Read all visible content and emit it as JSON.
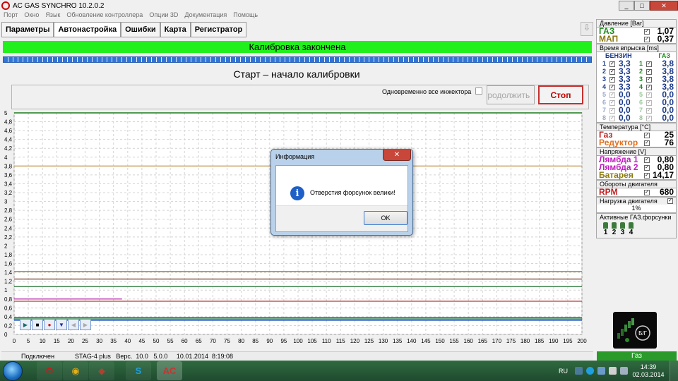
{
  "window": {
    "title": "AC GAS SYNCHRO  10.2.0.2",
    "ctrl_min": "_",
    "ctrl_max": "□",
    "ctrl_close": "✕"
  },
  "menu": [
    "Порт",
    "Окно",
    "Язык",
    "Обновление контроллера",
    "Опции 3D",
    "Документация",
    "Помощь"
  ],
  "tabs": [
    "Параметры",
    "Автонастройка",
    "Ошибки",
    "Карта",
    "Регистратор"
  ],
  "status_banner": "Калибровка закончена",
  "start_label": "Старт – начало калибровки",
  "simultaneous_label": "Одновременно все инжектора",
  "continue_button": "Продолжить",
  "stop_button": "Стоп",
  "chart_data": {
    "type": "line",
    "x_ticks": [
      0,
      5,
      10,
      15,
      20,
      25,
      30,
      35,
      40,
      45,
      50,
      55,
      60,
      65,
      70,
      75,
      80,
      85,
      90,
      95,
      100,
      105,
      110,
      115,
      120,
      125,
      130,
      135,
      140,
      145,
      150,
      155,
      160,
      165,
      170,
      175,
      180,
      185,
      190,
      195,
      200
    ],
    "y_ticks": [
      "0",
      "0,2",
      "0,4",
      "0,6",
      "0,8",
      "1",
      "1,2",
      "1,4",
      "1,6",
      "1,8",
      "2",
      "2,2",
      "2,4",
      "2,6",
      "2,8",
      "3",
      "3,2",
      "3,4",
      "3,6",
      "3,8",
      "4",
      "4,2",
      "4,4",
      "4,6",
      "4,8",
      "5"
    ],
    "xlim": [
      0,
      200
    ],
    "ylim": [
      0,
      5
    ],
    "grid": true,
    "series": [
      {
        "color": "#1a7a1a",
        "values": [
          [
            0,
            5
          ],
          [
            200,
            5
          ]
        ]
      },
      {
        "color": "#c8a060",
        "values": [
          [
            0,
            3.8
          ],
          [
            200,
            3.8
          ]
        ]
      },
      {
        "color": "#9a8a30",
        "values": [
          [
            0,
            1.42
          ],
          [
            200,
            1.42
          ]
        ]
      },
      {
        "color": "#8a6050",
        "values": [
          [
            0,
            1.25
          ],
          [
            200,
            1.25
          ]
        ]
      },
      {
        "color": "#2a7a3a",
        "values": [
          [
            0,
            1.08
          ],
          [
            200,
            1.08
          ]
        ]
      },
      {
        "color": "#c04cc0",
        "values": [
          [
            0,
            0.8
          ],
          [
            38,
            0.8
          ]
        ]
      },
      {
        "color": "#c04040",
        "values": [
          [
            0,
            0.75
          ],
          [
            200,
            0.75
          ]
        ]
      },
      {
        "color": "#2060a0",
        "values": [
          [
            0,
            0.38
          ],
          [
            200,
            0.38
          ]
        ]
      },
      {
        "color": "#208040",
        "values": [
          [
            0,
            0.35
          ],
          [
            200,
            0.35
          ]
        ]
      },
      {
        "color": "#1a50c0",
        "values": [
          [
            0,
            0.32
          ],
          [
            200,
            0.32
          ]
        ]
      }
    ]
  },
  "playback": [
    "▶",
    "■",
    "●",
    "▼",
    "◀",
    "▶"
  ],
  "statusbar": {
    "connection": "Подключен",
    "info": "STAG-4 plus   Верс.  10.0   5.0.0     10.01.2014  8:19:08"
  },
  "right_panel": {
    "pressure": {
      "header": "Давление [Bar]",
      "rows": [
        {
          "label": "ГАЗ",
          "value": "1,07",
          "color": "#1a8a1a"
        },
        {
          "label": "МАП",
          "value": "0,37",
          "color": "#8a7a10"
        }
      ]
    },
    "injection": {
      "header": "Время впрыска [ms]",
      "col1": "БЕНЗИН",
      "col2": "ГАЗ",
      "rows": [
        {
          "n": "1",
          "petrol": "3,3",
          "gas": "3,8",
          "on": true
        },
        {
          "n": "2",
          "petrol": "3,3",
          "gas": "3,8",
          "on": true
        },
        {
          "n": "3",
          "petrol": "3,3",
          "gas": "3,8",
          "on": true
        },
        {
          "n": "4",
          "petrol": "3,3",
          "gas": "3,8",
          "on": true
        },
        {
          "n": "5",
          "petrol": "0,0",
          "gas": "0,0",
          "on": false
        },
        {
          "n": "6",
          "petrol": "0,0",
          "gas": "0,0",
          "on": false
        },
        {
          "n": "7",
          "petrol": "0,0",
          "gas": "0,0",
          "on": false
        },
        {
          "n": "8",
          "petrol": "0,0",
          "gas": "0,0",
          "on": false
        }
      ]
    },
    "temperature": {
      "header": "Температура [°C]",
      "rows": [
        {
          "label": "Газ",
          "value": "25",
          "color": "#c02020"
        },
        {
          "label": "Редуктор",
          "value": "76",
          "color": "#e07020"
        }
      ]
    },
    "voltage": {
      "header": "Напряжение [V]",
      "rows": [
        {
          "label": "Лямбда 1",
          "value": "0,80",
          "color": "#c020c0"
        },
        {
          "label": "Лямбда 2",
          "value": "0,80",
          "color": "#c020c0"
        },
        {
          "label": "Батарея",
          "value": "14,17",
          "color": "#8a7a10"
        }
      ]
    },
    "rpm": {
      "header": "Обороты двигателя",
      "label": "RPM",
      "value": "680",
      "color": "#c02020"
    },
    "load": {
      "header": "Нагрузка двигателя",
      "value": "1%"
    },
    "active": {
      "header": "Активные ГАЗ.форсунки",
      "nozzles": [
        "1",
        "2",
        "3",
        "4"
      ]
    },
    "widget_label": "Б/Г",
    "gas_status": "Газ"
  },
  "dialog": {
    "title": "Информация",
    "icon": "i",
    "message": "Отверстия форсунок велики!",
    "ok": "OK",
    "close": "✕"
  },
  "taskbar": {
    "apps": [
      {
        "icon": "opera-icon",
        "glyph": "O",
        "color": "#d01818"
      },
      {
        "icon": "chrome-icon",
        "glyph": "◉",
        "color": "#e0b020"
      },
      {
        "icon": "pinned-app-icon",
        "glyph": "◆",
        "color": "#b04030"
      },
      {
        "icon": "skype-icon",
        "glyph": "S",
        "color": "#1ea0e0"
      },
      {
        "icon": "ac-gas-icon",
        "glyph": "AC",
        "color": "#d03030"
      }
    ],
    "lang": "RU",
    "time": "14:39",
    "date": "02.03.2014"
  }
}
